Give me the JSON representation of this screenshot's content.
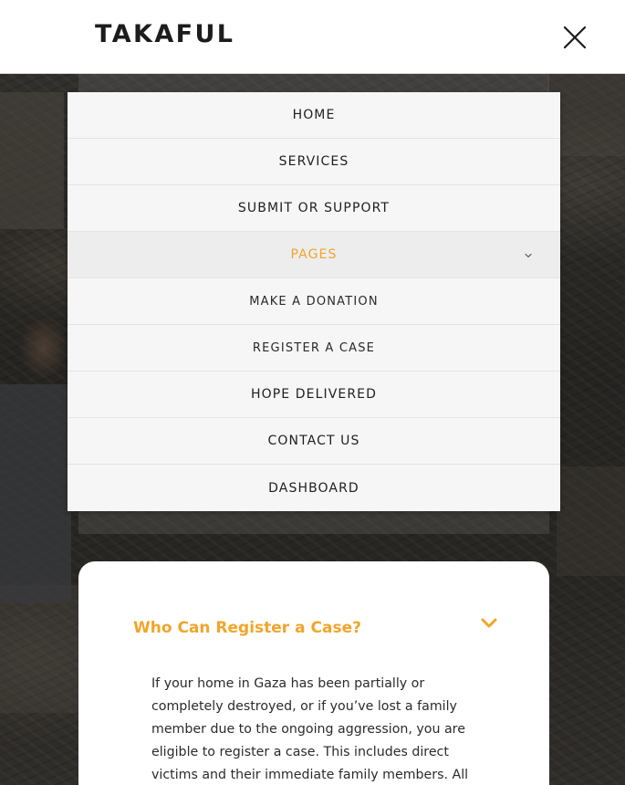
{
  "header": {
    "logo": "TAKAFUL",
    "close_icon": "close-icon"
  },
  "nav": {
    "items": [
      {
        "label": "HOME"
      },
      {
        "label": "SERVICES"
      },
      {
        "label": "SUBMIT OR SUPPORT"
      },
      {
        "label": "PAGES",
        "active": true,
        "icon": "chevron-down-icon"
      },
      {
        "label": "MAKE A DONATION",
        "submenu": true
      },
      {
        "label": "REGISTER A CASE",
        "submenu": true
      },
      {
        "label": "HOPE DELIVERED"
      },
      {
        "label": "CONTACT US"
      },
      {
        "label": "DASHBOARD"
      }
    ]
  },
  "faq": {
    "title": "Who Can Register a Case?",
    "toggle_icon": "chevron-down-icon",
    "body": "If your home in Gaza has been partially or completely destroyed, or if you’ve lost a family member due to the ongoing aggression, you are eligible to register a case. This includes direct victims and their immediate family members. All"
  },
  "colors": {
    "accent": "#f2a52a",
    "menu_bg": "#f6f6f6",
    "active_bg": "#ededed",
    "text": "#1f1f1f",
    "header_bg": "#ffffff"
  }
}
